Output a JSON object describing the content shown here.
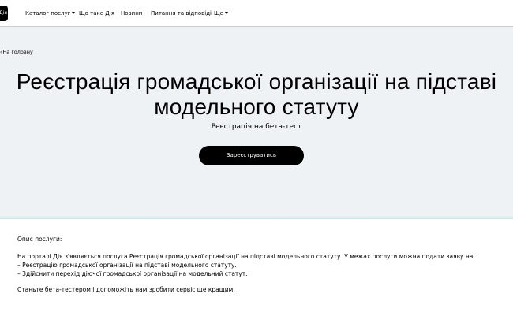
{
  "header": {
    "logo_text": "Дія",
    "nav": [
      {
        "label": "Каталог послуг",
        "has_caret": true
      },
      {
        "label": "Що таке Дія",
        "has_caret": false
      },
      {
        "label": "Новини",
        "has_caret": false
      },
      {
        "label": "Питання та відповіді",
        "has_caret": false
      },
      {
        "label": "Ще",
        "has_caret": true
      }
    ]
  },
  "hero": {
    "breadcrumb": "На головну",
    "title_line1": "Реєстрація громадської організації на підставі",
    "title_line2": "модельного статуту",
    "subtitle": "Реєстрація на бета-тест",
    "cta_label": "Зареєструватись"
  },
  "description": {
    "heading": "Опис послуги:",
    "intro": "На порталі Дія з'являється послуга Реєстрація громадської організації на підставі модельного статуту. У межах послуги можна подати заяву на:",
    "items": [
      "– Реєстрацію громадської організації на підставі модельного статуту.",
      "– Здійснити перехід діючої громадської організації на модельний статут."
    ],
    "closing": "Станьте бета-тестером і допоможіть нам зробити сервіс ще кращим."
  },
  "colors": {
    "header_bg": "#ffffff",
    "page_bg": "#eef2f5",
    "button_bg": "#000000",
    "button_text": "#ffffff",
    "card_accent": "#dff3f1"
  }
}
